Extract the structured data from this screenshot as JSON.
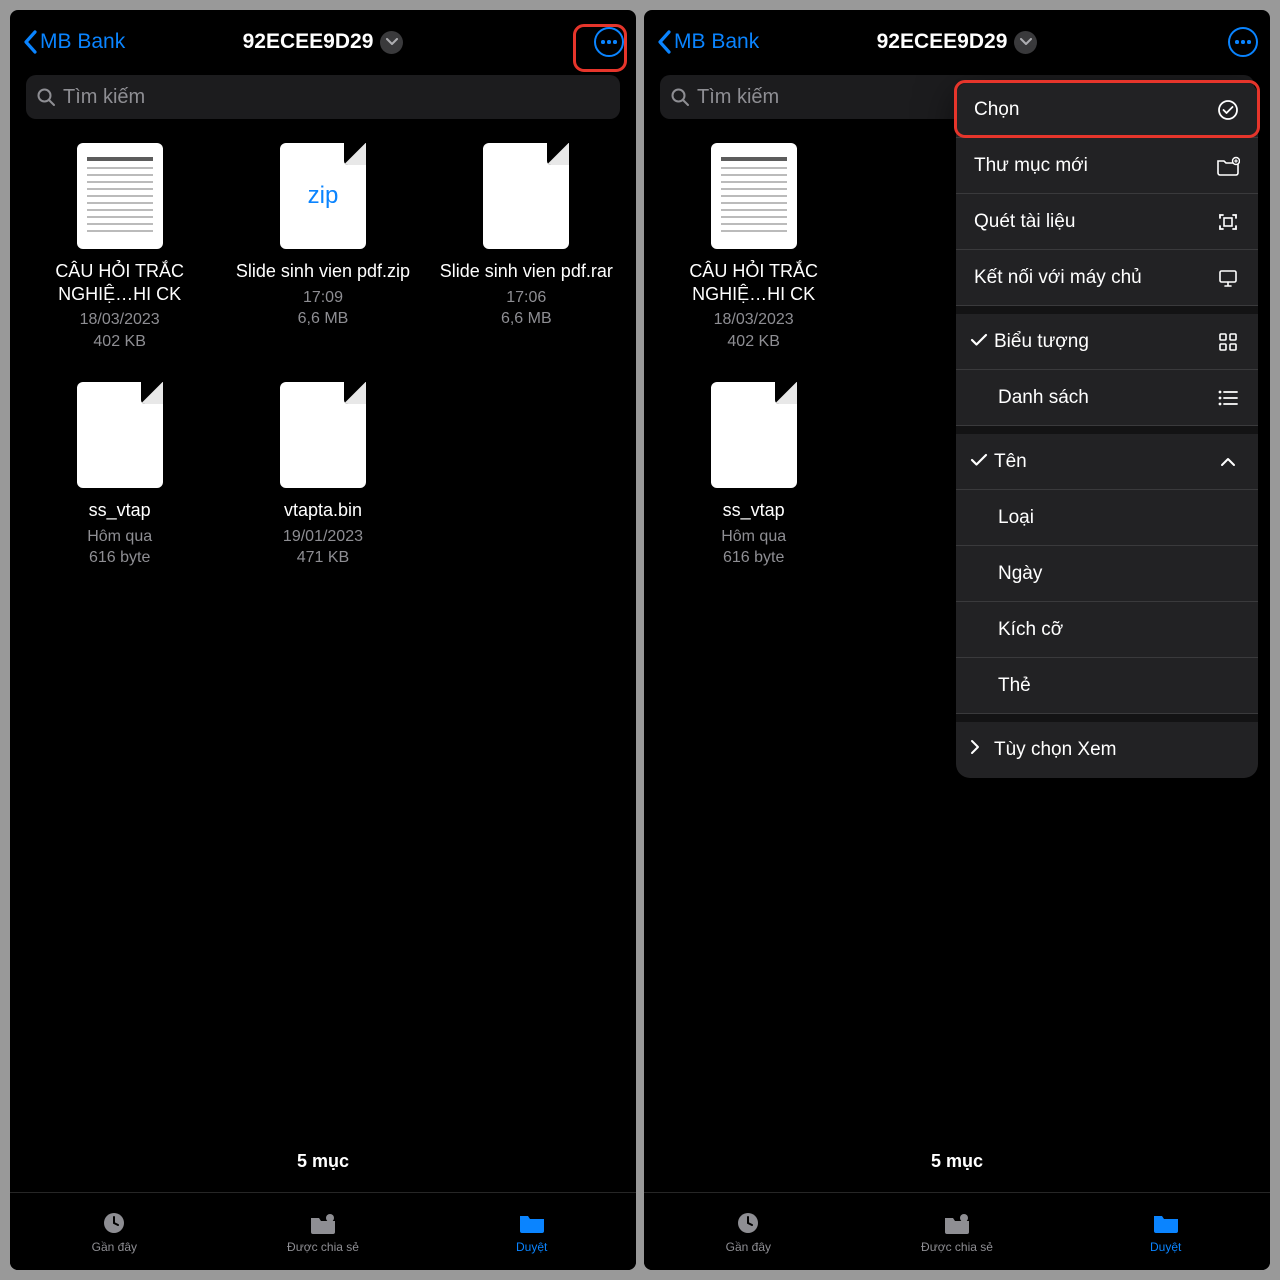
{
  "nav": {
    "back_label": "MB Bank",
    "title": "92ECEE9D29"
  },
  "search": {
    "placeholder": "Tìm kiếm"
  },
  "files": [
    {
      "name": "CÂU HỎI TRẮC NGHIỆ…HI CK",
      "date": "18/03/2023",
      "size": "402 KB",
      "kind": "doc"
    },
    {
      "name": "Slide sinh vien pdf.zip",
      "date": "17:09",
      "size": "6,6 MB",
      "kind": "zip"
    },
    {
      "name": "Slide sinh vien pdf.rar",
      "date": "17:06",
      "size": "6,6 MB",
      "kind": "blank"
    },
    {
      "name": "ss_vtap",
      "date": "Hôm qua",
      "size": "616 byte",
      "kind": "blank"
    },
    {
      "name": "vtapta.bin",
      "date": "19/01/2023",
      "size": "471 KB",
      "kind": "blank"
    }
  ],
  "right_files": [
    {
      "name": "CÂU HỎI TRẮC NGHIỆ…HI CK",
      "date": "18/03/2023",
      "size": "402 KB",
      "kind": "doc"
    },
    {
      "name": "ss_vtap",
      "date": "Hôm qua",
      "size": "616 byte",
      "kind": "blank"
    }
  ],
  "count_text": "5 mục",
  "tabs": {
    "recent": "Gần đây",
    "shared": "Được chia sẻ",
    "browse": "Duyệt"
  },
  "menu": {
    "select": "Chọn",
    "new_folder": "Thư mục mới",
    "scan": "Quét tài liệu",
    "connect": "Kết nối với máy chủ",
    "icons": "Biểu tượng",
    "list": "Danh sách",
    "name": "Tên",
    "type": "Loại",
    "date": "Ngày",
    "size": "Kích cỡ",
    "tags": "Thẻ",
    "view_options": "Tùy chọn Xem"
  }
}
